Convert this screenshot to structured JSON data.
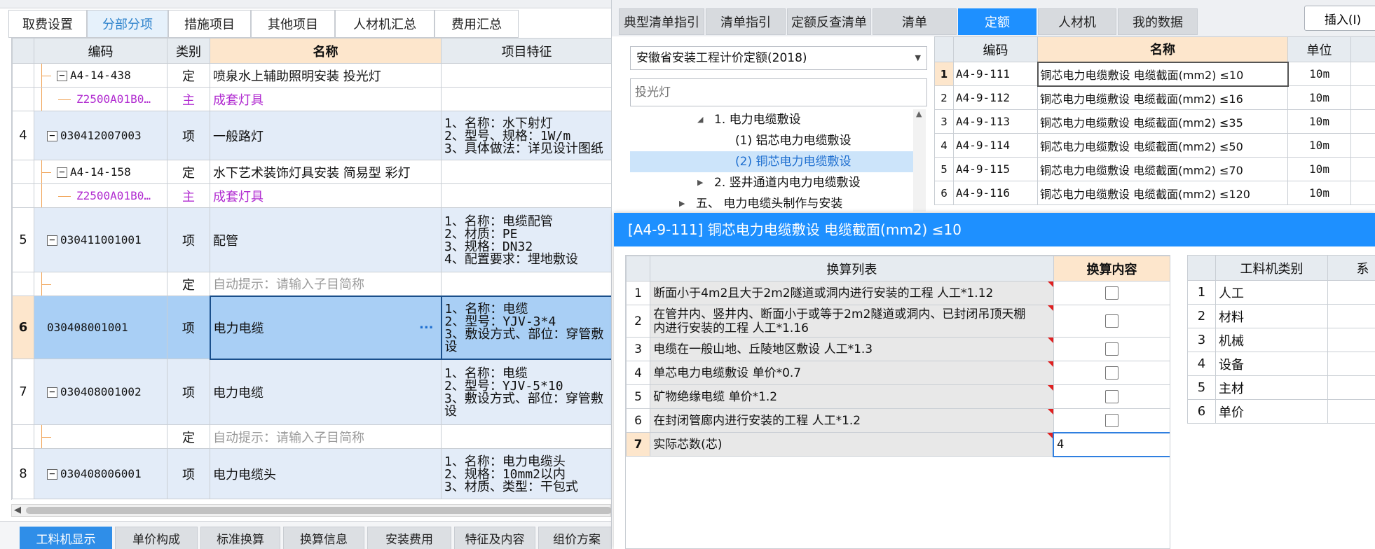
{
  "left_tabs": [
    {
      "label": "取费设置",
      "active": false
    },
    {
      "label": "分部分项",
      "active": true
    },
    {
      "label": "措施项目",
      "active": false
    },
    {
      "label": "其他项目",
      "active": false
    },
    {
      "label": "人材机汇总",
      "active": false
    },
    {
      "label": "费用汇总",
      "active": false
    }
  ],
  "grid_headers": {
    "code": "编码",
    "type": "类别",
    "name": "名称",
    "feature": "项目特征"
  },
  "grid_rows": [
    {
      "idx": "",
      "tree": "minus",
      "code": "A4-14-438",
      "type": "定",
      "name": "喷泉水上辅助照明安装 投光灯",
      "feature": [],
      "kind": "ding"
    },
    {
      "idx": "",
      "tree": "none",
      "code": "Z2500A01B0…",
      "type": "主",
      "name": "成套灯具",
      "feature": [],
      "kind": "zhu"
    },
    {
      "idx": "4",
      "tree": "minus",
      "code": "030412007003",
      "type": "项",
      "name": "一般路灯",
      "feature": [
        "1、名称：水下射灯",
        "2、型号、规格：1W/m",
        "3、具体做法：详见设计图纸"
      ],
      "kind": "xiang"
    },
    {
      "idx": "",
      "tree": "minus",
      "code": "A4-14-158",
      "type": "定",
      "name": "水下艺术装饰灯具安装 简易型 彩灯",
      "feature": [],
      "kind": "ding"
    },
    {
      "idx": "",
      "tree": "none",
      "code": "Z2500A01B0…",
      "type": "主",
      "name": "成套灯具",
      "feature": [],
      "kind": "zhu"
    },
    {
      "idx": "5",
      "tree": "minus",
      "code": "030411001001",
      "type": "项",
      "name": "配管",
      "feature": [
        "1、名称：电缆配管",
        "2、材质：PE",
        "3、规格：DN32",
        "4、配置要求：埋地敷设"
      ],
      "kind": "xiang"
    },
    {
      "idx": "",
      "tree": "none",
      "code": "",
      "type": "定",
      "name": "自动提示：请输入子目简称",
      "feature": [],
      "kind": "hint"
    },
    {
      "idx": "6",
      "tree": "none",
      "code": "030408001001",
      "type": "项",
      "name": "电力电缆",
      "feature": [
        "1、名称：电缆",
        "2、型号：YJV-3*4",
        "3、敷设方式、部位：穿管敷设"
      ],
      "kind": "sel"
    },
    {
      "idx": "7",
      "tree": "minus",
      "code": "030408001002",
      "type": "项",
      "name": "电力电缆",
      "feature": [
        "1、名称：电缆",
        "2、型号：YJV-5*10",
        "3、敷设方式、部位：穿管敷设"
      ],
      "kind": "xiang"
    },
    {
      "idx": "",
      "tree": "none",
      "code": "",
      "type": "定",
      "name": "自动提示：请输入子目简称",
      "feature": [],
      "kind": "hint"
    },
    {
      "idx": "8",
      "tree": "minus",
      "code": "030408006001",
      "type": "项",
      "name": "电力电缆头",
      "feature": [
        "1、名称：电力电缆头",
        "2、规格：10mm2以内",
        "3、材质、类型：干包式"
      ],
      "kind": "xiang"
    }
  ],
  "ellipsis": "···",
  "bottom_tabs": [
    {
      "label": "工料机显示",
      "active": true
    },
    {
      "label": "单价构成",
      "active": false
    },
    {
      "label": "标准换算",
      "active": false
    },
    {
      "label": "换算信息",
      "active": false
    },
    {
      "label": "安装费用",
      "active": false
    },
    {
      "label": "特征及内容",
      "active": false
    },
    {
      "label": "组价方案",
      "active": false
    }
  ],
  "right_tabs": [
    {
      "label": "典型清单指引",
      "active": false
    },
    {
      "label": "清单指引",
      "active": false
    },
    {
      "label": "定额反查清单",
      "active": false
    },
    {
      "label": "清单",
      "active": false
    },
    {
      "label": "定额",
      "active": true
    },
    {
      "label": "人材机",
      "active": false
    },
    {
      "label": "我的数据",
      "active": false
    }
  ],
  "insert_button": "插入(I)",
  "quota_select": "安徽省安装工程计价定额(2018)",
  "search_placeholder": "投光灯",
  "tree": [
    {
      "label": "1. 电力电缆敷设",
      "level": 1,
      "expand": "down",
      "selected": false
    },
    {
      "label": "(1) 铝芯电力电缆敷设",
      "level": 2,
      "expand": "",
      "selected": false
    },
    {
      "label": "(2) 铜芯电力电缆敷设",
      "level": 2,
      "expand": "",
      "selected": true
    },
    {
      "label": "2. 竖井通道内电力电缆敷设",
      "level": 1,
      "expand": "right",
      "selected": false
    },
    {
      "label": "五、 电力电缆头制作与安装",
      "level": 0,
      "expand": "right",
      "selected": false
    }
  ],
  "result_headers": {
    "code": "编码",
    "name": "名称",
    "unit": "单位"
  },
  "results": [
    {
      "n": "1",
      "code": "A4-9-111",
      "name": "铜芯电力电缆敷设 电缆截面(mm2) ≤10",
      "unit": "10m"
    },
    {
      "n": "2",
      "code": "A4-9-112",
      "name": "铜芯电力电缆敷设 电缆截面(mm2) ≤16",
      "unit": "10m"
    },
    {
      "n": "3",
      "code": "A4-9-113",
      "name": "铜芯电力电缆敷设 电缆截面(mm2) ≤35",
      "unit": "10m"
    },
    {
      "n": "4",
      "code": "A4-9-114",
      "name": "铜芯电力电缆敷设 电缆截面(mm2) ≤50",
      "unit": "10m"
    },
    {
      "n": "5",
      "code": "A4-9-115",
      "name": "铜芯电力电缆敷设 电缆截面(mm2) ≤70",
      "unit": "10m"
    },
    {
      "n": "6",
      "code": "A4-9-116",
      "name": "铜芯电力电缆敷设 电缆截面(mm2) ≤120",
      "unit": "10m"
    }
  ],
  "dialog_title": "[A4-9-111] 铜芯电力电缆敷设 电缆截面(mm2) ≤10",
  "conv_headers": {
    "list": "换算列表",
    "content": "换算内容"
  },
  "conversions": [
    {
      "n": "1",
      "text": [
        "断面小于4m2且大于2m2隧道或洞内进行安装的工程 人工*1.12"
      ],
      "value": "",
      "type": "checkbox"
    },
    {
      "n": "2",
      "text": [
        "在管井内、竖井内、断面小于或等于2m2隧道或洞内、已封闭吊顶天棚",
        "内进行安装的工程 人工*1.16"
      ],
      "value": "",
      "type": "checkbox"
    },
    {
      "n": "3",
      "text": [
        "电缆在一般山地、丘陵地区敷设 人工*1.3"
      ],
      "value": "",
      "type": "checkbox"
    },
    {
      "n": "4",
      "text": [
        "单芯电力电缆敷设 单价*0.7"
      ],
      "value": "",
      "type": "checkbox"
    },
    {
      "n": "5",
      "text": [
        "矿物绝缘电缆 单价*1.2"
      ],
      "value": "",
      "type": "checkbox"
    },
    {
      "n": "6",
      "text": [
        "在封闭管廊内进行安装的工程 人工*1.2"
      ],
      "value": "",
      "type": "checkbox"
    },
    {
      "n": "7",
      "text": [
        "实际芯数(芯)"
      ],
      "value": "4",
      "type": "input"
    }
  ],
  "mat_headers": {
    "type": "工料机类别",
    "coef": "系"
  },
  "materials": [
    {
      "n": "1",
      "label": "人工"
    },
    {
      "n": "2",
      "label": "材料"
    },
    {
      "n": "3",
      "label": "机械"
    },
    {
      "n": "4",
      "label": "设备"
    },
    {
      "n": "5",
      "label": "主材"
    },
    {
      "n": "6",
      "label": "单价"
    }
  ],
  "colors": {
    "accent": "#1e90ff",
    "selected_row": "#a9cff5",
    "header_highlight": "#fde6cc",
    "dialog_title": "#1e90ff"
  }
}
